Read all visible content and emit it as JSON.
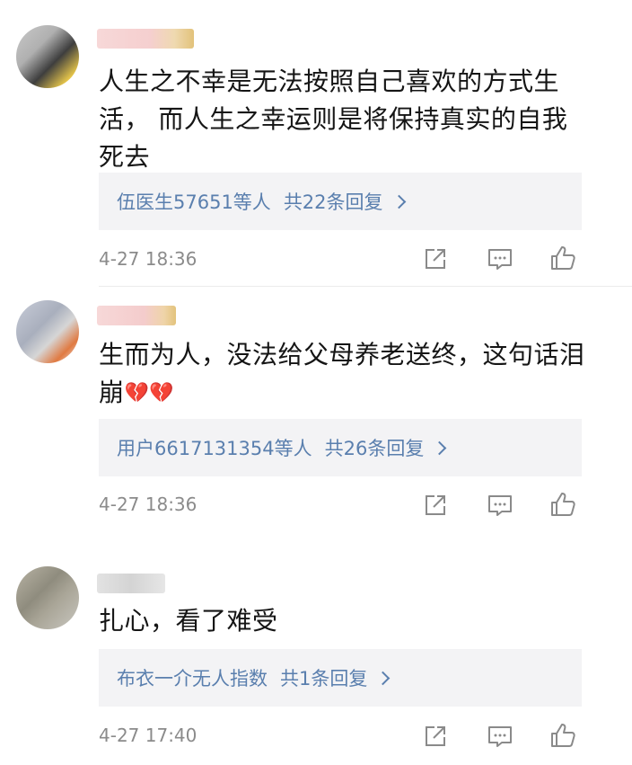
{
  "comments": [
    {
      "text_lines": [
        "人生之不幸是无法按照自己喜欢的方式生",
        "活， 而人生之幸运则是将保持真实的自我",
        "死去"
      ],
      "emoji": "",
      "reply_who": "伍医生57651等人",
      "reply_count": "共22条回复",
      "time": "4-27 18:36"
    },
    {
      "text_lines": [
        "生而为人，没法给父母养老送终，这句话泪",
        "崩"
      ],
      "emoji": "💔💔",
      "reply_who": "用户6617131354等人",
      "reply_count": "共26条回复",
      "time": "4-27 18:36"
    },
    {
      "text_lines": [
        "扎心，看了难受"
      ],
      "emoji": "",
      "reply_who": "布衣一介无人指数",
      "reply_count": "共1条回复",
      "time": "4-27 17:40"
    }
  ],
  "icons": {
    "share": "share-icon",
    "comment": "comment-icon",
    "like": "thumbs-up-icon"
  },
  "colors": {
    "link": "#5a7fae",
    "reply_bg": "#f3f3f5",
    "meta": "#8b8b8b",
    "heart": "#d8283a"
  }
}
